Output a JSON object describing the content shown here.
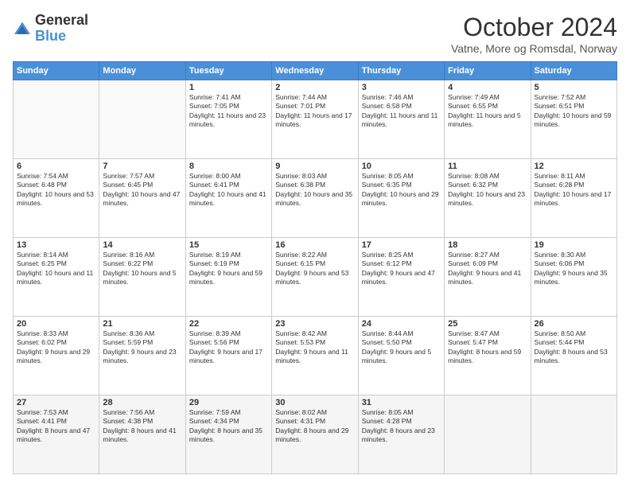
{
  "logo": {
    "line1": "General",
    "line2": "Blue"
  },
  "title": "October 2024",
  "subtitle": "Vatne, More og Romsdal, Norway",
  "days_of_week": [
    "Sunday",
    "Monday",
    "Tuesday",
    "Wednesday",
    "Thursday",
    "Friday",
    "Saturday"
  ],
  "weeks": [
    [
      {
        "day": "",
        "info": ""
      },
      {
        "day": "",
        "info": ""
      },
      {
        "day": "1",
        "info": "Sunrise: 7:41 AM\nSunset: 7:05 PM\nDaylight: 11 hours and 23 minutes."
      },
      {
        "day": "2",
        "info": "Sunrise: 7:44 AM\nSunset: 7:01 PM\nDaylight: 11 hours and 17 minutes."
      },
      {
        "day": "3",
        "info": "Sunrise: 7:46 AM\nSunset: 6:58 PM\nDaylight: 11 hours and 11 minutes."
      },
      {
        "day": "4",
        "info": "Sunrise: 7:49 AM\nSunset: 6:55 PM\nDaylight: 11 hours and 5 minutes."
      },
      {
        "day": "5",
        "info": "Sunrise: 7:52 AM\nSunset: 6:51 PM\nDaylight: 10 hours and 59 minutes."
      }
    ],
    [
      {
        "day": "6",
        "info": "Sunrise: 7:54 AM\nSunset: 6:48 PM\nDaylight: 10 hours and 53 minutes."
      },
      {
        "day": "7",
        "info": "Sunrise: 7:57 AM\nSunset: 6:45 PM\nDaylight: 10 hours and 47 minutes."
      },
      {
        "day": "8",
        "info": "Sunrise: 8:00 AM\nSunset: 6:41 PM\nDaylight: 10 hours and 41 minutes."
      },
      {
        "day": "9",
        "info": "Sunrise: 8:03 AM\nSunset: 6:38 PM\nDaylight: 10 hours and 35 minutes."
      },
      {
        "day": "10",
        "info": "Sunrise: 8:05 AM\nSunset: 6:35 PM\nDaylight: 10 hours and 29 minutes."
      },
      {
        "day": "11",
        "info": "Sunrise: 8:08 AM\nSunset: 6:32 PM\nDaylight: 10 hours and 23 minutes."
      },
      {
        "day": "12",
        "info": "Sunrise: 8:11 AM\nSunset: 6:28 PM\nDaylight: 10 hours and 17 minutes."
      }
    ],
    [
      {
        "day": "13",
        "info": "Sunrise: 8:14 AM\nSunset: 6:25 PM\nDaylight: 10 hours and 11 minutes."
      },
      {
        "day": "14",
        "info": "Sunrise: 8:16 AM\nSunset: 6:22 PM\nDaylight: 10 hours and 5 minutes."
      },
      {
        "day": "15",
        "info": "Sunrise: 8:19 AM\nSunset: 6:19 PM\nDaylight: 9 hours and 59 minutes."
      },
      {
        "day": "16",
        "info": "Sunrise: 8:22 AM\nSunset: 6:15 PM\nDaylight: 9 hours and 53 minutes."
      },
      {
        "day": "17",
        "info": "Sunrise: 8:25 AM\nSunset: 6:12 PM\nDaylight: 9 hours and 47 minutes."
      },
      {
        "day": "18",
        "info": "Sunrise: 8:27 AM\nSunset: 6:09 PM\nDaylight: 9 hours and 41 minutes."
      },
      {
        "day": "19",
        "info": "Sunrise: 8:30 AM\nSunset: 6:06 PM\nDaylight: 9 hours and 35 minutes."
      }
    ],
    [
      {
        "day": "20",
        "info": "Sunrise: 8:33 AM\nSunset: 6:02 PM\nDaylight: 9 hours and 29 minutes."
      },
      {
        "day": "21",
        "info": "Sunrise: 8:36 AM\nSunset: 5:59 PM\nDaylight: 9 hours and 23 minutes."
      },
      {
        "day": "22",
        "info": "Sunrise: 8:39 AM\nSunset: 5:56 PM\nDaylight: 9 hours and 17 minutes."
      },
      {
        "day": "23",
        "info": "Sunrise: 8:42 AM\nSunset: 5:53 PM\nDaylight: 9 hours and 11 minutes."
      },
      {
        "day": "24",
        "info": "Sunrise: 8:44 AM\nSunset: 5:50 PM\nDaylight: 9 hours and 5 minutes."
      },
      {
        "day": "25",
        "info": "Sunrise: 8:47 AM\nSunset: 5:47 PM\nDaylight: 8 hours and 59 minutes."
      },
      {
        "day": "26",
        "info": "Sunrise: 8:50 AM\nSunset: 5:44 PM\nDaylight: 8 hours and 53 minutes."
      }
    ],
    [
      {
        "day": "27",
        "info": "Sunrise: 7:53 AM\nSunset: 4:41 PM\nDaylight: 8 hours and 47 minutes."
      },
      {
        "day": "28",
        "info": "Sunrise: 7:56 AM\nSunset: 4:38 PM\nDaylight: 8 hours and 41 minutes."
      },
      {
        "day": "29",
        "info": "Sunrise: 7:59 AM\nSunset: 4:34 PM\nDaylight: 8 hours and 35 minutes."
      },
      {
        "day": "30",
        "info": "Sunrise: 8:02 AM\nSunset: 4:31 PM\nDaylight: 8 hours and 29 minutes."
      },
      {
        "day": "31",
        "info": "Sunrise: 8:05 AM\nSunset: 4:28 PM\nDaylight: 8 hours and 23 minutes."
      },
      {
        "day": "",
        "info": ""
      },
      {
        "day": "",
        "info": ""
      }
    ]
  ]
}
